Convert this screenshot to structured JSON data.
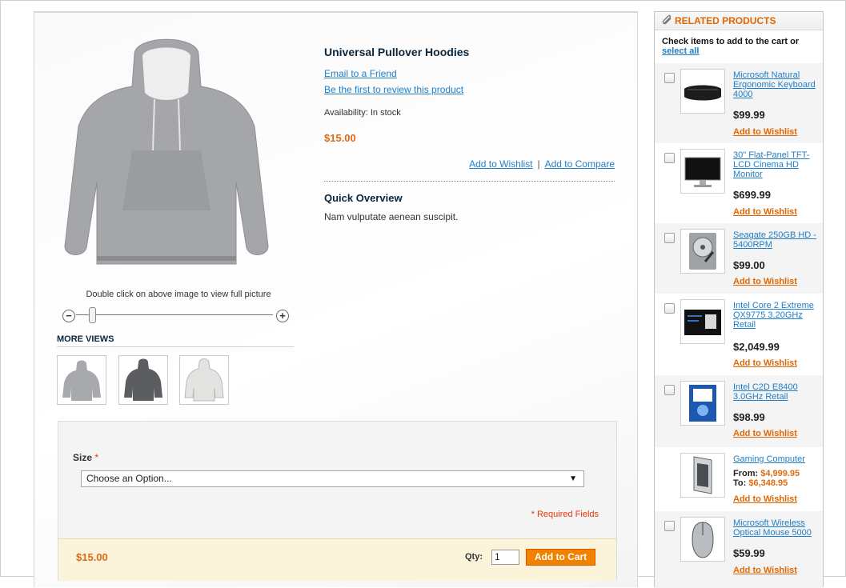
{
  "product": {
    "name": "Universal Pullover Hoodies",
    "email_link": "Email to a Friend",
    "review_link": "Be the first to review this product",
    "availability": "Availability: In stock",
    "price": "$15.00",
    "add_to_wishlist": "Add to Wishlist",
    "separator": "|",
    "add_to_compare": "Add to Compare",
    "overview_title": "Quick Overview",
    "overview_text": "Nam vulputate aenean suscipit.",
    "zoom_hint": "Double click on above image to view full picture",
    "more_views_title": "MORE VIEWS",
    "zoom_level": 0.05
  },
  "options": {
    "size_label": "Size",
    "required_star": "*",
    "select_value": "Choose an Option...",
    "select_arrow": "▼",
    "required_note": "* Required Fields"
  },
  "cart": {
    "price": "$15.00",
    "qty_label": "Qty:",
    "qty_value": "1",
    "button_label": "Add to Cart"
  },
  "related": {
    "title": "RELATED PRODUCTS",
    "intro": "Check items to add to the cart or",
    "select_all": "select all",
    "wishlist_label": "Add to Wishlist",
    "items": [
      {
        "name": "Microsoft Natural Ergonomic Keyboard 4000",
        "price": "$99.99",
        "icon": "keyboard-icon"
      },
      {
        "name": "30\" Flat-Panel TFT-LCD Cinema HD Monitor",
        "price": "$699.99",
        "icon": "monitor-icon"
      },
      {
        "name": "Seagate 250GB HD - 5400RPM",
        "price": "$99.00",
        "icon": "hard-drive-icon"
      },
      {
        "name": "Intel Core 2 Extreme QX9775 3.20GHz Retail",
        "price": "$2,049.99",
        "icon": "cpu-box-icon"
      },
      {
        "name": "Intel C2D E8400 3.0GHz Retail",
        "price": "$98.99",
        "icon": "cpu-box-icon"
      },
      {
        "name": "Gaming Computer",
        "from_label": "From:",
        "from_price": "$4,999.95",
        "to_label": "To:",
        "to_price": "$6,348.95",
        "icon": "computer-case-icon"
      },
      {
        "name": "Microsoft Wireless Optical Mouse 5000",
        "price": "$59.99",
        "icon": "mouse-icon"
      }
    ]
  },
  "colors": {
    "accent": "#df6a12",
    "link": "#1e7ec8",
    "button": "#f18200",
    "required": "#eb340a"
  }
}
